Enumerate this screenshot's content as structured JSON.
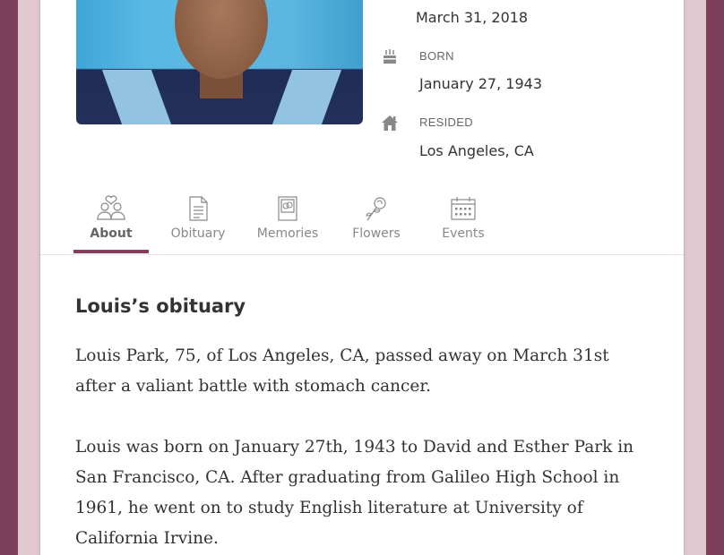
{
  "profile": {
    "passed_date": "March 31, 2018",
    "born_label": "BORN",
    "born_date": "January 27, 1943",
    "resided_label": "RESIDED",
    "resided_place": "Los Angeles, CA"
  },
  "tabs": [
    {
      "label": "About",
      "icon": "people-heart-icon",
      "active": true
    },
    {
      "label": "Obituary",
      "icon": "document-icon",
      "active": false
    },
    {
      "label": "Memories",
      "icon": "photo-frame-icon",
      "active": false
    },
    {
      "label": "Flowers",
      "icon": "rose-icon",
      "active": false
    },
    {
      "label": "Events",
      "icon": "calendar-icon",
      "active": false
    }
  ],
  "obituary": {
    "title": "Louis’s obituary",
    "paragraphs": [
      "Louis Park, 75, of Los Angeles, CA, passed away on March 31st after a valiant battle with stomach cancer.",
      "Louis was born on January 27th, 1943 to David and Esther Park in San Francisco, CA. After graduating from Galileo High School in 1961, he went on to study English literature at University of California Irvine."
    ]
  },
  "colors": {
    "page_background": "#7e3f5b",
    "frame": "#dfc8d0",
    "accent": "#8b3b5c",
    "icon_gray": "#888888"
  }
}
